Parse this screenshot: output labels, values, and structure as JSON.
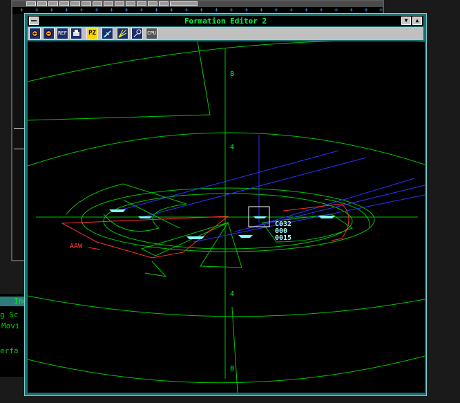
{
  "background_window": {
    "plus_row": "  +   +   +   +   +   +   +   +   +   +   +   +   +   +   +   +   +   +   +   +   +   +   +   +   +   +   +   +   +   +   +"
  },
  "left_panel": {
    "header": "Ind",
    "lines": [
      "g Sc",
      "Movi",
      "erfa"
    ]
  },
  "window": {
    "title": "Formation Editor 2"
  },
  "toolbar": {
    "tools": [
      {
        "icon": "zoom-in-icon",
        "label": "+"
      },
      {
        "icon": "zoom-out-icon",
        "label": "−"
      },
      {
        "icon": "ref-icon",
        "label": "REF"
      },
      {
        "icon": "print-icon",
        "label": ""
      },
      {
        "icon": "pz-icon",
        "label": "PZ"
      },
      {
        "icon": "aircraft-icon",
        "label": ""
      },
      {
        "icon": "sweep-icon",
        "label": ""
      },
      {
        "icon": "sensor-icon",
        "label": ""
      },
      {
        "icon": "cpu-icon",
        "label": "CPU"
      }
    ]
  },
  "plot": {
    "range_labels": [
      "8",
      "4",
      "4",
      "8"
    ],
    "selected_contact": {
      "course": "C032",
      "line2": "000",
      "line3": "0015"
    },
    "hostile_label": "AAW",
    "colors": {
      "rings": "#00c800",
      "hostile": "#ff3030",
      "bearing": "#3030ff",
      "contact": "#80ffff"
    }
  }
}
